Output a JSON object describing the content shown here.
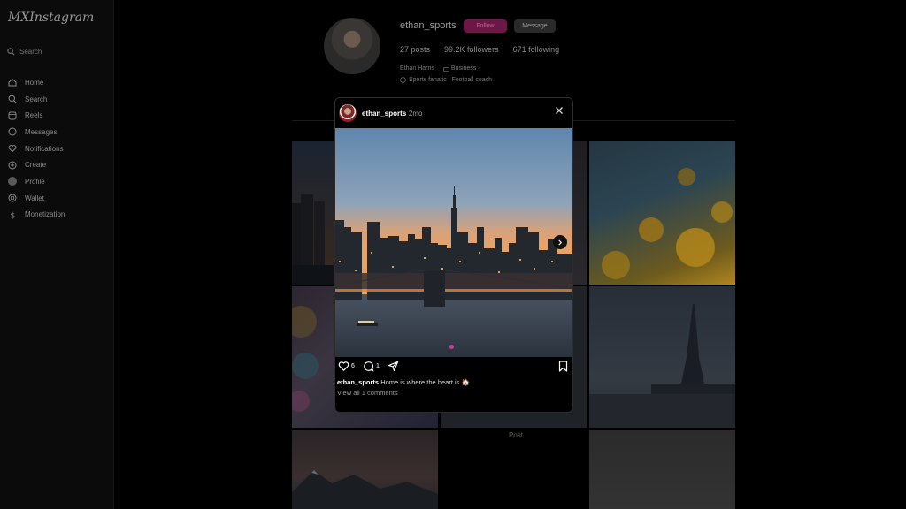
{
  "app": {
    "logo": "MXInstagram"
  },
  "sidebar": {
    "search_placeholder": "Search",
    "items": [
      {
        "label": "Home",
        "icon": "home-icon"
      },
      {
        "label": "Search",
        "icon": "search-icon"
      },
      {
        "label": "Reels",
        "icon": "reels-icon"
      },
      {
        "label": "Messages",
        "icon": "messages-icon"
      },
      {
        "label": "Notifications",
        "icon": "heart-icon"
      },
      {
        "label": "Create",
        "icon": "plus-icon"
      },
      {
        "label": "Profile",
        "icon": "avatar"
      },
      {
        "label": "Wallet",
        "icon": "wallet-icon"
      },
      {
        "label": "Monetization",
        "icon": "dollar-icon"
      }
    ]
  },
  "profile": {
    "username": "ethan_sports",
    "follow_label": "Follow",
    "message_label": "Message",
    "posts": "27 posts",
    "followers": "99.2K followers",
    "following": "671 following",
    "name": "Ethan Harris",
    "category": "Business",
    "bio": "Sports fanatic | Football coach"
  },
  "grid": {
    "post_label": "Post"
  },
  "modal": {
    "username": "ethan_sports",
    "time": "· 2mo",
    "likes": "6",
    "comments": "1",
    "caption_user": "ethan_sports",
    "caption_text": "Home is where the heart is 🏠",
    "view_comments": "View all 1 comments"
  },
  "colors": {
    "accent": "#b8479a",
    "follow_bg": "#6c1746"
  }
}
